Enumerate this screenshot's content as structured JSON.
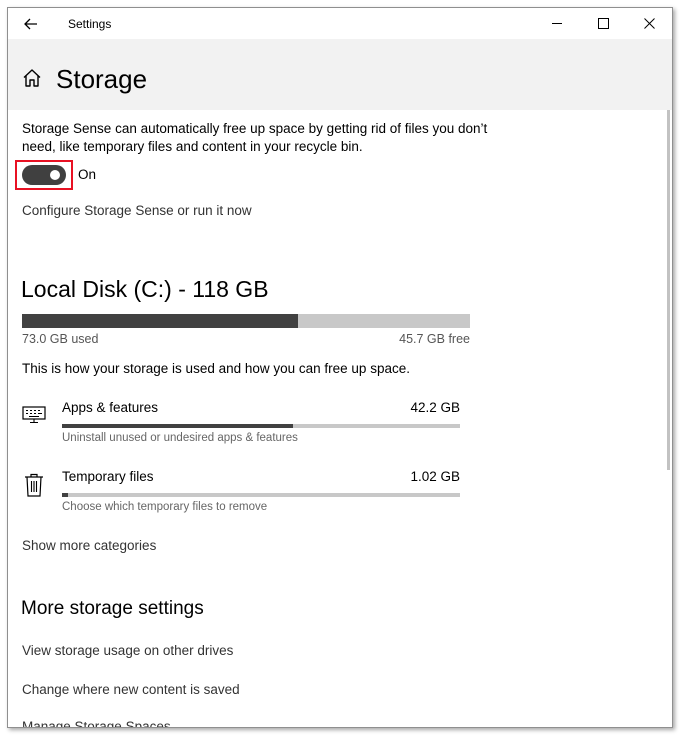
{
  "titlebar": {
    "title": "Settings"
  },
  "page": {
    "title": "Storage"
  },
  "storage_sense": {
    "description": "Storage Sense can automatically free up space by getting rid of files you don’t need, like temporary files and content in your recycle bin.",
    "toggle_state": "On",
    "configure_link": "Configure Storage Sense or run it now"
  },
  "disk": {
    "title": "Local Disk (C:) - 118 GB",
    "used_label": "73.0 GB used",
    "free_label": "45.7 GB free",
    "used_fraction": 0.615,
    "info": "This is how your storage is used and how you can free up space."
  },
  "categories": [
    {
      "name": "Apps & features",
      "size": "42.2 GB",
      "subtitle": "Uninstall unused or undesired apps & features",
      "fraction": 0.58,
      "icon": "keyboard-icon"
    },
    {
      "name": "Temporary files",
      "size": "1.02 GB",
      "subtitle": "Choose which temporary files to remove",
      "fraction": 0.015,
      "icon": "trash-icon"
    }
  ],
  "show_more": "Show more categories",
  "more_settings": {
    "title": "More storage settings",
    "links": [
      "View storage usage on other drives",
      "Change where new content is saved",
      "Manage Storage Spaces"
    ]
  },
  "colors": {
    "bar_fill": "#414141",
    "bar_track": "#c8c8c8",
    "highlight": "#e81123"
  }
}
